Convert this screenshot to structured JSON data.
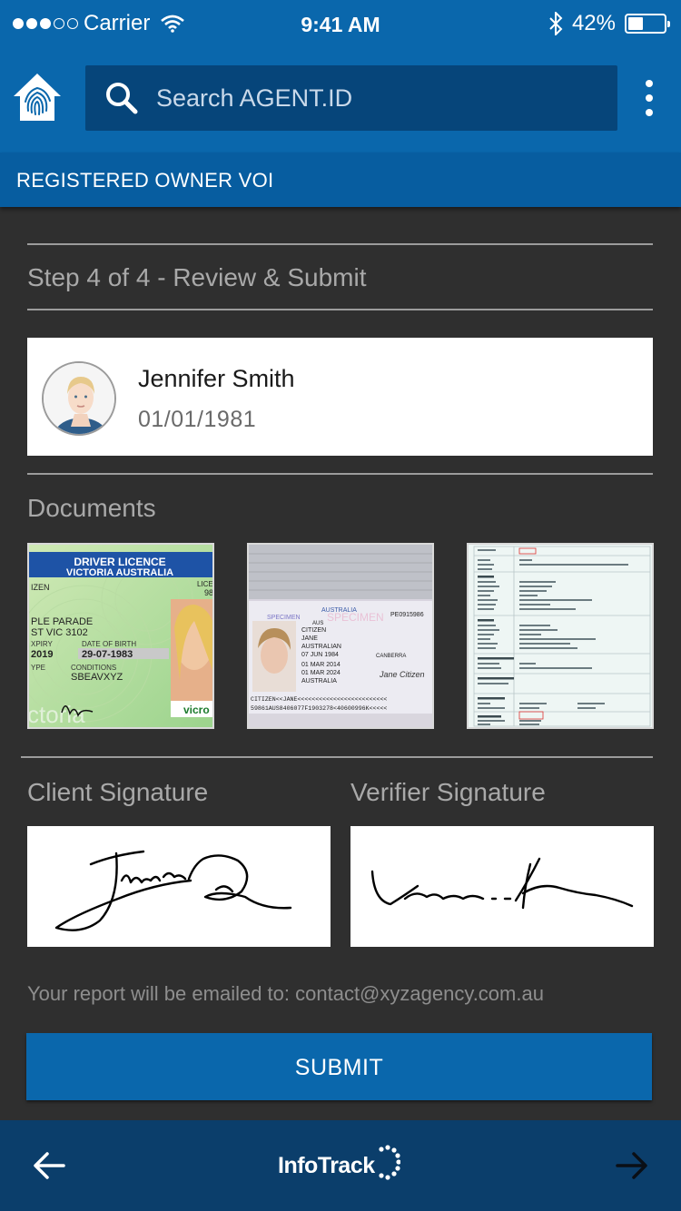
{
  "status_bar": {
    "carrier": "Carrier",
    "time": "9:41 AM",
    "battery": "42%",
    "battery_level": 0.42
  },
  "header": {
    "search_placeholder_prefix": "Search ",
    "search_placeholder_brand": "AGENT.ID",
    "home_icon": "fingerprint-house-icon",
    "menu_icon": "kebab-icon"
  },
  "subheader": {
    "title": "REGISTERED OWNER VOI"
  },
  "step": {
    "text": "Step 4 of 4  - Review & Submit"
  },
  "person": {
    "name": "Jennifer Smith",
    "dob": "01/01/1981"
  },
  "documents": {
    "label": "Documents",
    "licence": {
      "title": "DRIVER LICENCE",
      "subtitle": "VICTORIA AUSTRALIA",
      "izen": "IZEN",
      "lic": "LICE",
      "lic_num": "98",
      "addr1": "PLE PARADE",
      "addr2": "ST VIC 3102",
      "expiry_label": "XPIRY",
      "expiry": "2019",
      "dob_label": "DATE OF BIRTH",
      "dob": "29-07-1983",
      "type": "YPE",
      "conditions_label": "CONDITIONS",
      "conditions": "SBEAVXYZ",
      "bottom": "ctoria",
      "vic": "vicro"
    },
    "passport": {
      "header": "AUSTRALIA",
      "specimen": "SPECIMEN",
      "number": "PE0915986",
      "aus": "AUS",
      "citizen": "CITIZEN",
      "jane": "JANE",
      "nationality": "AUSTRALIAN",
      "dob": "07 JUN 1984",
      "place": "CANBERRA",
      "issue": "01 MAR 2014",
      "expiry": "01 MAR 2024",
      "country": "AUSTRALIA",
      "signature": "Jane Citizen",
      "mrz1": "CITIZEN<<JANE<<<<<<<<<<<<<<<<<<<<<<<<<",
      "mrz2": "59861AUS8406077F1903278<40600996K<<<<<"
    }
  },
  "signatures": {
    "client_label": "Client Signature",
    "verifier_label": "Verifier Signature"
  },
  "email": {
    "note": "Your report will be emailed to: contact@xyzagency.com.au"
  },
  "submit": {
    "label": "SUBMIT"
  },
  "footer": {
    "logo_text": "InfoTrack",
    "back_icon": "arrow-left-icon",
    "forward_icon": "arrow-right-icon"
  },
  "colors": {
    "primary": "#0a67ac",
    "search_bg": "#06457a",
    "footer_bg": "#0b3e6b",
    "page_bg": "#2f2f2f"
  }
}
